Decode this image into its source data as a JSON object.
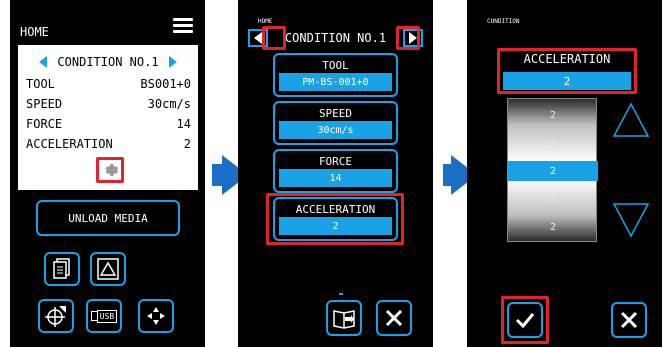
{
  "colors": {
    "accent": "#1aa2e6",
    "highlight": "#e0242e",
    "flow_arrow": "#1a6fc4"
  },
  "panel1": {
    "title": "HOME",
    "condition_label": "CONDITION NO.1",
    "rows": [
      {
        "label": "TOOL",
        "value": "BS001+0"
      },
      {
        "label": "SPEED",
        "value": "30cm/s"
      },
      {
        "label": "FORCE",
        "value": "14"
      },
      {
        "label": "ACCELERATION",
        "value": "2"
      }
    ],
    "unload_label": "UNLOAD MEDIA",
    "usb_label": "USB",
    "icons": [
      "menu-icon",
      "gear-icon",
      "copy-icon",
      "triangle-icon",
      "origin-icon",
      "usb-icon",
      "move-icon"
    ]
  },
  "panel2": {
    "title": "HOME",
    "condition_label": "CONDITION NO.1",
    "fields": [
      {
        "label": "TOOL",
        "value": "PM-BS-001+0"
      },
      {
        "label": "SPEED",
        "value": "30cm/s"
      },
      {
        "label": "FORCE",
        "value": "14"
      },
      {
        "label": "ACCELERATION",
        "value": "2"
      }
    ],
    "icons": [
      "book-icon",
      "close-icon"
    ]
  },
  "panel3": {
    "title": "CONDITION",
    "acc_label": "ACCELERATION",
    "acc_value": "2",
    "drum_values": [
      "2",
      "1",
      "2",
      "1",
      "2"
    ],
    "icons": [
      "up-arrow-icon",
      "down-arrow-icon",
      "check-icon",
      "close-icon"
    ]
  }
}
